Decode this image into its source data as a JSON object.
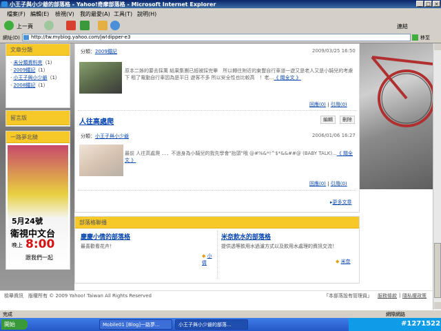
{
  "window": {
    "title": "小王子與小少爺的部落格 - Yahoo!奇摩部落格 - Microsoft Internet Explorer",
    "minimize": "_",
    "maximize": "□",
    "close": "×"
  },
  "menu": [
    "檔案(F)",
    "編輯(E)",
    "檢視(V)",
    "我的最愛(A)",
    "工具(T)",
    "說明(H)"
  ],
  "toolbar": {
    "back": "上一頁",
    "links": "連結"
  },
  "address": {
    "label": "網址(D)",
    "url": "http://tw.myblog.yahoo.com/jw!dipper-e3",
    "go": "移至"
  },
  "sidebar": {
    "categories_title": "文章分類",
    "categories": [
      {
        "name": "未分類資料夾",
        "count": "（1）"
      },
      {
        "name": "2009鐵記",
        "count": "（1）"
      },
      {
        "name": "小王子與小少爺",
        "count": "（1）"
      },
      {
        "name": "2008鐵記",
        "count": "（1）"
      }
    ],
    "guestbook_title": "留言版",
    "travel_title": "一路夢北騎",
    "ad": {
      "date": "5月24號",
      "channel": "衛視中文台",
      "prefix": "晚上",
      "time": "8:00",
      "tag": "跟我們一起"
    }
  },
  "posts": [
    {
      "category_label": "分類：",
      "category": "2009鐵記",
      "date": "2009/03/25 16:50",
      "excerpt": "原本二姊的要去採萬 結果集團已經被採完畢　所以轉往附近的東豐自行車道一遊又是老人又是小騎兒的考慮下 租了電動自行車因為是平日 遊客不多 所以安全性也比較高　！老...",
      "read_more": "《 閱全文 》",
      "links": [
        "回應(0)",
        "引用(0)"
      ]
    },
    {
      "title": "人往高處爬",
      "edit": "編輯",
      "delete": "刪除",
      "category_label": "分類：",
      "category": "小王子與小少爺",
      "date": "2006/01/06 16:27",
      "excerpt": "最前 人往高處爬 ．．．不過身為小騎兒的我先學會\"抬頭\"哦 @#%&*!^$*&&##@ (BABY TALK)...",
      "read_more": "《 閱全文 》",
      "links": [
        "回應(0)",
        "引用(0)"
      ]
    }
  ],
  "more_posts": "更多文章",
  "friends": {
    "title": "部落格聯播",
    "items": [
      {
        "name": "慶慶小倩的部落格",
        "desc": "最喜歡看花卉！",
        "author": "小倩"
      },
      {
        "name": "米奈飲水的部落格",
        "desc": "提供透等飲用水過濾方式以及飲用水處理的資訊交流！",
        "author": "米奈"
      }
    ]
  },
  "footer": {
    "left": "檢舉資訊　版權所有 © 2009 Yahoo! Taiwan All Rights Reserved",
    "manager": "「本部落設有管理員」",
    "terms": "服務條款",
    "privacy": "隱私權政策"
  },
  "status": {
    "text": "完成",
    "zone": "網際網路"
  },
  "taskbar": {
    "start": "開始",
    "tasks": [
      "Mobile01 [Blog]一路夢...",
      "小王子與小少爺的部落..."
    ],
    "watermark": "#1271522"
  }
}
